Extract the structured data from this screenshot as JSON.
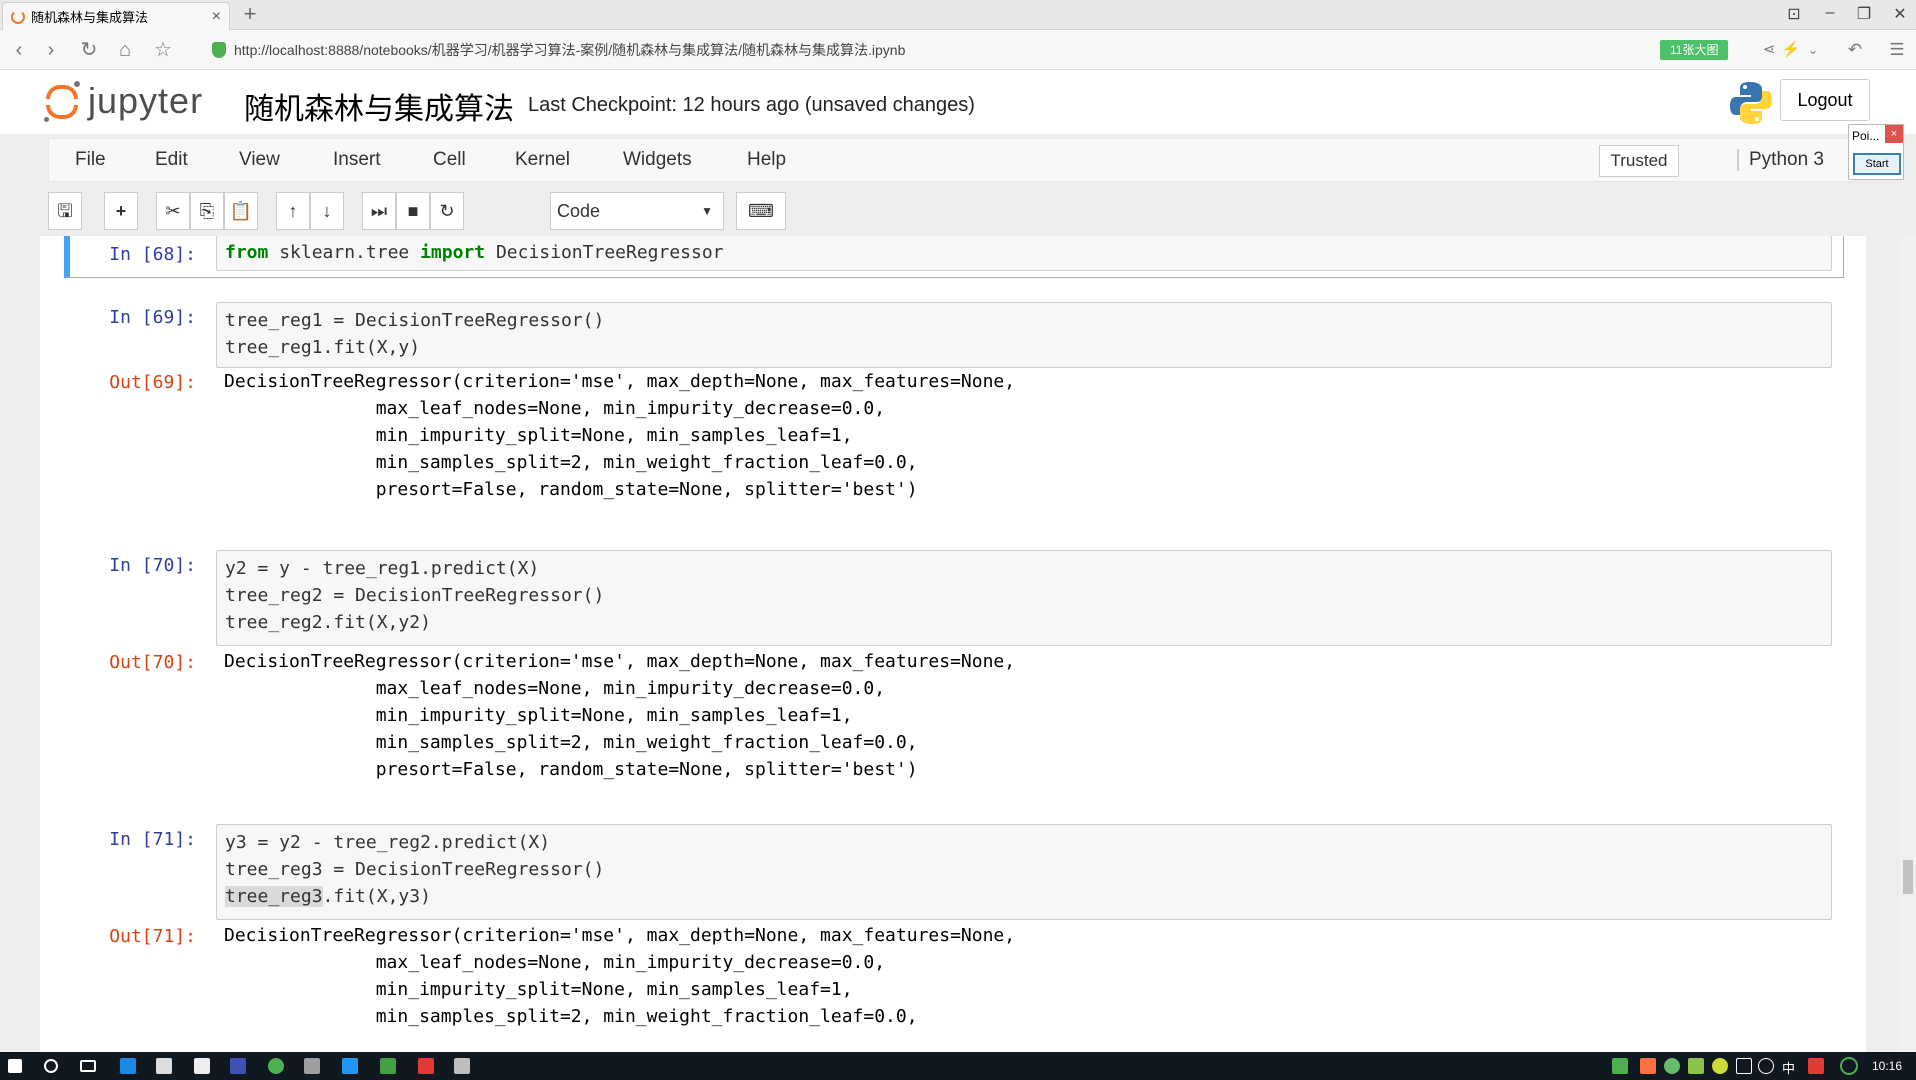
{
  "browser": {
    "tab_title": "随机森林与集成算法",
    "url": "http://localhost:8888/notebooks/机器学习/机器学习算法-案例/随机森林与集成算法/随机森林与集成算法.ipynb",
    "badge": "11张大图"
  },
  "header": {
    "logo_text": "jupyter",
    "notebook_name": "随机森林与集成算法",
    "checkpoint": "Last Checkpoint: 12 hours ago (unsaved changes)",
    "logout_label": "Logout"
  },
  "menubar": {
    "items": [
      "File",
      "Edit",
      "View",
      "Insert",
      "Cell",
      "Kernel",
      "Widgets",
      "Help"
    ],
    "trusted_label": "Trusted",
    "kernel_label": "Python 3"
  },
  "popup": {
    "title": "Poi...",
    "close": "×",
    "start": "Start"
  },
  "toolbar": {
    "cell_type": "Code"
  },
  "cells": [
    {
      "prompt": "In [68]:",
      "code_prefix_kw1": "from",
      "code_mid": " sklearn.tree ",
      "code_prefix_kw2": "import",
      "code_end": " DecisionTreeRegressor"
    },
    {
      "prompt": "In [69]:",
      "code": "tree_reg1 = DecisionTreeRegressor()\ntree_reg1.fit(X,y)",
      "out_prompt": "Out[69]:",
      "output": "DecisionTreeRegressor(criterion='mse', max_depth=None, max_features=None,\n              max_leaf_nodes=None, min_impurity_decrease=0.0,\n              min_impurity_split=None, min_samples_leaf=1,\n              min_samples_split=2, min_weight_fraction_leaf=0.0,\n              presort=False, random_state=None, splitter='best')"
    },
    {
      "prompt": "In [70]:",
      "code": "y2 = y - tree_reg1.predict(X)\ntree_reg2 = DecisionTreeRegressor()\ntree_reg2.fit(X,y2)",
      "out_prompt": "Out[70]:",
      "output": "DecisionTreeRegressor(criterion='mse', max_depth=None, max_features=None,\n              max_leaf_nodes=None, min_impurity_decrease=0.0,\n              min_impurity_split=None, min_samples_leaf=1,\n              min_samples_split=2, min_weight_fraction_leaf=0.0,\n              presort=False, random_state=None, splitter='best')"
    },
    {
      "prompt": "In [71]:",
      "code_line1": "y3 = y2 - tree_reg2.predict(X)",
      "code_line2": "tree_reg3 = DecisionTreeRegressor()",
      "code_line3_sel": "tree_reg3",
      "code_line3_rest": ".fit(X,y3)",
      "out_prompt": "Out[71]:",
      "output": "DecisionTreeRegressor(criterion='mse', max_depth=None, max_features=None,\n              max_leaf_nodes=None, min_impurity_decrease=0.0,\n              min_impurity_split=None, min_samples_leaf=1,\n              min_samples_split=2, min_weight_fraction_leaf=0.0,"
    }
  ],
  "taskbar": {
    "ime": "中",
    "clock": "10:16"
  }
}
